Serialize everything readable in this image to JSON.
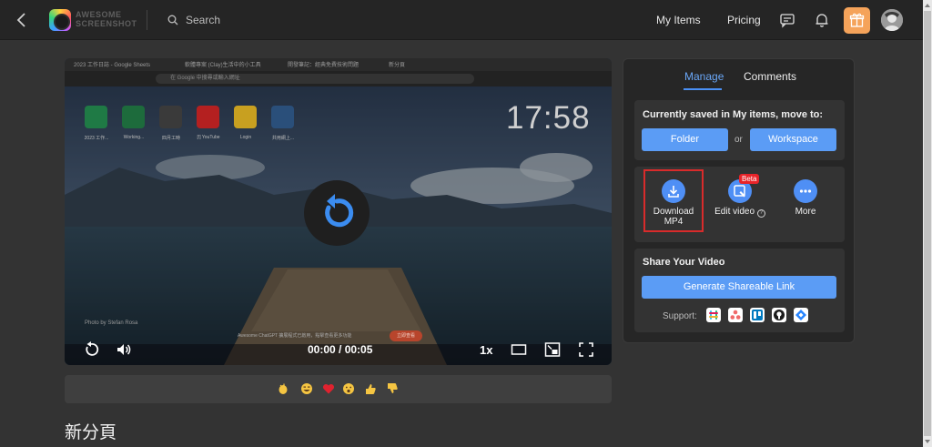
{
  "app": {
    "brand_line1": "AWESOME",
    "brand_line2": "SCREENSHOT"
  },
  "header": {
    "search_placeholder": "Search",
    "my_items": "My Items",
    "pricing": "Pricing"
  },
  "video": {
    "clock": "17:58",
    "timecode": "00:00 / 00:05",
    "speed": "1x",
    "browser_tabs": [
      "2023 工作日誌 - Google Sheets",
      "軟體專案 (Clay)生活中的小工具",
      "開發筆記：經典免費技術問題",
      "新分頁"
    ],
    "url_placeholder": "在 Google 中搜尋或輸入網址",
    "desktop_icons": [
      "2023 工作...",
      "Working...",
      "四月工時",
      "[!] YouTube",
      "Login",
      "共用網上..."
    ],
    "credit": "Photo by Stefan Rosa",
    "notice": "Awesome ChatGPT 擴展程式已啟用，點擊查看更多功能",
    "notice_button": "立即查看"
  },
  "reactions": [
    "clap-emoji",
    "laugh-emoji",
    "heart-emoji",
    "surprised-emoji",
    "thumbs-up-emoji",
    "thumbs-down-emoji"
  ],
  "page": {
    "heading": "新分頁"
  },
  "panel": {
    "tabs": {
      "manage": "Manage",
      "comments": "Comments"
    },
    "move": {
      "title": "Currently saved in My items, move to:",
      "folder": "Folder",
      "or": "or",
      "workspace": "Workspace"
    },
    "actions": {
      "download_line1": "Download",
      "download_line2": "MP4",
      "edit": "Edit video",
      "beta": "Beta",
      "more": "More"
    },
    "share": {
      "title": "Share Your Video",
      "generate": "Generate Shareable Link",
      "support": "Support:"
    },
    "support_apps": [
      "slack-icon",
      "asana-icon",
      "trello-icon",
      "github-icon",
      "jira-icon"
    ]
  },
  "colors": {
    "accent": "#5b9cf5",
    "highlight_border": "#d92b2b",
    "beta_badge": "#e8242a",
    "gift": "#f5a35a"
  }
}
